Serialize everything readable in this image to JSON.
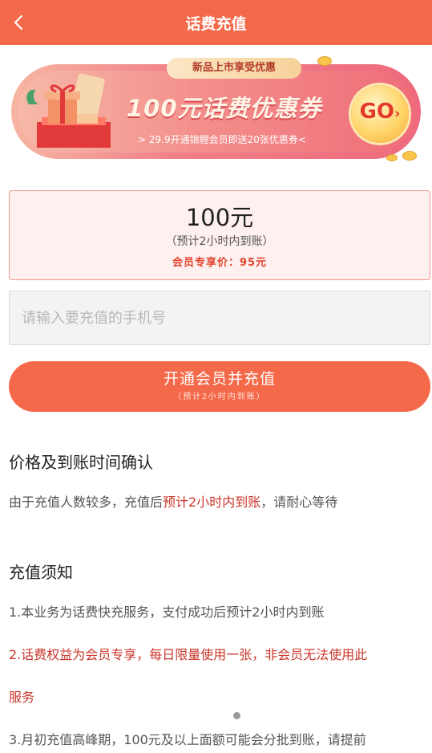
{
  "header": {
    "title": "话费充值"
  },
  "banner": {
    "tag": "新品上市享受优惠",
    "title": "100元话费优惠券",
    "subtitle": "> 29.9开通锦鲤会员即送20张优惠券<",
    "go_label": "GO",
    "go_arrow": "›"
  },
  "amount": {
    "value": "100元",
    "note": "（预计2小时内到账）",
    "member_price": "会员专享价：95元"
  },
  "phone": {
    "placeholder": "请输入要充值的手机号",
    "value": ""
  },
  "submit": {
    "label": "开通会员并充值",
    "note": "（预计2小时内到账）"
  },
  "section_price": {
    "title": "价格及到账时间确认",
    "text_before": "由于充值人数较多，充值后",
    "text_highlight": "预计2小时内到账",
    "text_after": "，请耐心等待"
  },
  "section_notes": {
    "title": "充值须知",
    "item1": "1.本业务为话费快充服务，支付成功后预计2小时内到账",
    "item2_line1": "2.话费权益为会员专享，每日限量使用一张，非会员无法使用此",
    "item2_line2": "服务",
    "item3": "3.月初充值高峰期，100元及以上面额可能会分批到账，请提前"
  },
  "colors": {
    "primary": "#f4694a",
    "accent_red": "#c9362a",
    "price_red": "#e2442f"
  },
  "icons": {
    "back": "chevron-left-icon"
  }
}
